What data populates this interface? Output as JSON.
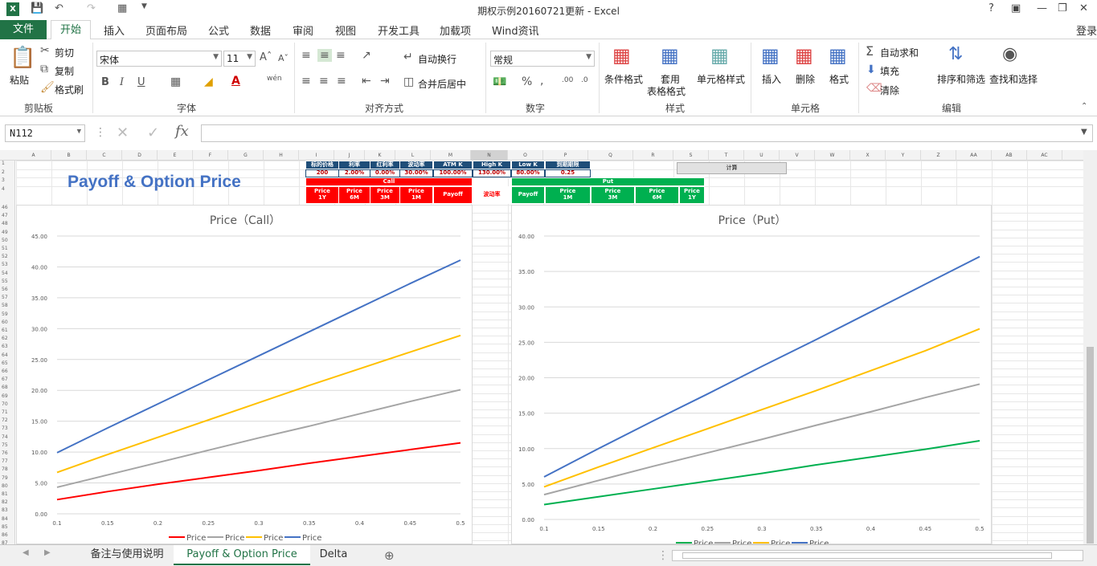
{
  "window": {
    "title": "期权示例20160721更新 - Excel",
    "signin": "登录"
  },
  "ribbon_tabs": [
    "文件",
    "开始",
    "插入",
    "页面布局",
    "公式",
    "数据",
    "审阅",
    "视图",
    "开发工具",
    "加载项",
    "Wind资讯"
  ],
  "clipboard": {
    "paste": "粘贴",
    "cut": "剪切",
    "copy": "复制",
    "format_painter": "格式刷",
    "group": "剪贴板"
  },
  "font": {
    "name": "宋体",
    "size": "11",
    "group": "字体",
    "bold": "B",
    "italic": "I",
    "underline": "U"
  },
  "alignment": {
    "wrap": "自动换行",
    "merge": "合并后居中",
    "group": "对齐方式"
  },
  "number": {
    "format": "常规",
    "group": "数字"
  },
  "styles": {
    "cond": "条件格式",
    "table1": "套用",
    "table2": "表格格式",
    "cell": "单元格样式",
    "group": "样式"
  },
  "cells": {
    "insert": "插入",
    "delete": "删除",
    "format": "格式",
    "group": "单元格"
  },
  "editing": {
    "autosum": "自动求和",
    "fill": "填充",
    "clear": "清除",
    "sort": "排序和筛选",
    "find": "查找和选择",
    "group": "编辑"
  },
  "formula_bar": {
    "namebox": "N112",
    "fx": "fx",
    "content": ""
  },
  "columns": [
    "A",
    "B",
    "C",
    "D",
    "E",
    "F",
    "G",
    "H",
    "I",
    "J",
    "K",
    "L",
    "M",
    "N",
    "O",
    "P",
    "Q",
    "R",
    "S",
    "T",
    "U",
    "V",
    "W",
    "X",
    "Y",
    "Z",
    "AA",
    "AB",
    "AC"
  ],
  "rows": [
    "1",
    "2",
    "3",
    "4",
    "46",
    "47",
    "48",
    "49",
    "50",
    "51",
    "52",
    "53",
    "54",
    "55",
    "56",
    "57",
    "58",
    "59",
    "60",
    "61",
    "62",
    "63",
    "64",
    "65",
    "66",
    "67",
    "68",
    "69",
    "70",
    "71",
    "72",
    "73",
    "74",
    "75",
    "76",
    "77",
    "78",
    "79",
    "80",
    "81",
    "82",
    "83",
    "84",
    "85",
    "86",
    "87"
  ],
  "sheet": {
    "big_title": "Payoff & Option Price",
    "params_headers": [
      "标的价格",
      "利率",
      "红利率",
      "波动率",
      "ATM K",
      "High K",
      "Low K",
      "到期期限"
    ],
    "params_values": [
      "200",
      "2.00%",
      "0.00%",
      "30.00%",
      "100.00%",
      "130.00%",
      "80.00%",
      "0.25"
    ],
    "call_label": "Call",
    "put_label": "Put",
    "calc_button": "计算",
    "call_headers": [
      "Price\n1Y",
      "Price\n6M",
      "Price\n3M",
      "Price\n1M",
      "Payoff"
    ],
    "mid_label": "波动率",
    "put_headers": [
      "Payoff",
      "Price\n1M",
      "Price\n3M",
      "Price\n6M",
      "Price\n1Y"
    ]
  },
  "chart_data": [
    {
      "type": "line",
      "title": "Price（Call）",
      "x": [
        0.1,
        0.15,
        0.2,
        0.25,
        0.3,
        0.35,
        0.4,
        0.45,
        0.5
      ],
      "xticks": [
        "0.1",
        "0.15",
        "0.2",
        "0.25",
        "0.3",
        "0.35",
        "0.4",
        "0.45",
        "0.5"
      ],
      "ylim": [
        0,
        45
      ],
      "yticks": [
        "0.00",
        "5.00",
        "10.00",
        "15.00",
        "20.00",
        "25.00",
        "30.00",
        "35.00",
        "40.00",
        "45.00"
      ],
      "series": [
        {
          "name": "Price",
          "color": "#ff0000",
          "values": [
            2.3,
            3.6,
            4.8,
            5.9,
            7.0,
            8.2,
            9.3,
            10.4,
            11.5
          ]
        },
        {
          "name": "Price",
          "color": "#a5a5a5",
          "values": [
            4.3,
            6.3,
            8.3,
            10.3,
            12.3,
            14.2,
            16.2,
            18.2,
            20.1
          ]
        },
        {
          "name": "Price",
          "color": "#ffc000",
          "values": [
            6.7,
            9.6,
            12.4,
            15.2,
            18.0,
            20.8,
            23.5,
            26.2,
            28.9
          ]
        },
        {
          "name": "Price",
          "color": "#4472c4",
          "values": [
            9.9,
            13.9,
            17.8,
            21.7,
            25.6,
            29.5,
            33.4,
            37.3,
            41.1
          ]
        }
      ]
    },
    {
      "type": "line",
      "title": "Price（Put）",
      "x": [
        0.1,
        0.15,
        0.2,
        0.25,
        0.3,
        0.35,
        0.4,
        0.45,
        0.5
      ],
      "xticks": [
        "0.1",
        "0.15",
        "0.2",
        "0.25",
        "0.3",
        "0.35",
        "0.4",
        "0.45",
        "0.5"
      ],
      "ylim": [
        0,
        40
      ],
      "yticks": [
        "0.00",
        "5.00",
        "10.00",
        "15.00",
        "20.00",
        "25.00",
        "30.00",
        "35.00",
        "40.00"
      ],
      "series": [
        {
          "name": "Price",
          "color": "#00b050",
          "values": [
            2.1,
            3.2,
            4.3,
            5.4,
            6.5,
            7.7,
            8.8,
            9.9,
            11.1
          ]
        },
        {
          "name": "Price",
          "color": "#a5a5a5",
          "values": [
            3.5,
            5.5,
            7.5,
            9.4,
            11.3,
            13.3,
            15.2,
            17.2,
            19.1
          ]
        },
        {
          "name": "Price",
          "color": "#ffc000",
          "values": [
            4.6,
            7.4,
            10.1,
            12.8,
            15.5,
            18.2,
            21.0,
            23.8,
            26.9
          ]
        },
        {
          "name": "Price",
          "color": "#4472c4",
          "values": [
            6.0,
            10.0,
            13.9,
            17.7,
            21.6,
            25.4,
            29.3,
            33.2,
            37.1
          ]
        }
      ]
    }
  ],
  "sheet_tabs": [
    "备注与使用说明",
    "Payoff & Option Price",
    "Delta"
  ]
}
